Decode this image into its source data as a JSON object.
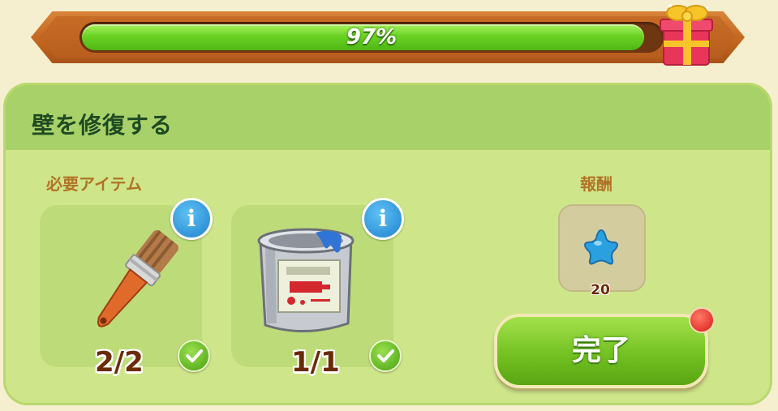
{
  "progress": {
    "value_fraction": 0.97,
    "label": "97%"
  },
  "task": {
    "title": "壁を修復する",
    "required_label": "必要アイテム",
    "reward_label": "報酬"
  },
  "items": [
    {
      "name": "paintbrush",
      "count": "2/2",
      "complete": true
    },
    {
      "name": "paint-can",
      "count": "1/1",
      "complete": true
    }
  ],
  "reward": {
    "icon": "blue-star-icon",
    "amount": "20"
  },
  "complete_button": {
    "label": "完了",
    "has_notification": true
  },
  "colors": {
    "progress_green": "#6ad324",
    "frame_orange": "#c76c26",
    "panel_green": "#cfe58a",
    "header_green": "#a8d16a",
    "title_text": "#1f4a22",
    "section_label": "#b07428",
    "count_text": "#6a2a06",
    "info_blue": "#1f83cf",
    "notification_red": "#d61b12"
  }
}
